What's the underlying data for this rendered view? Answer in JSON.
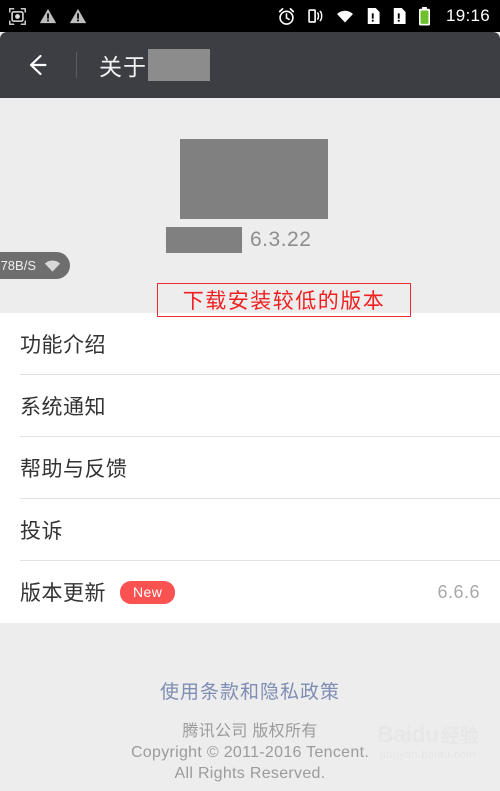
{
  "statusbar": {
    "time": "19:16",
    "left_icons": [
      "screenshot-icon",
      "warning-triangle-icon",
      "warning-triangle-icon"
    ],
    "right_icons": [
      "alarm-clock-icon",
      "vibrate-icon",
      "wifi-icon",
      "sim1-alert-icon",
      "sim2-alert-icon",
      "battery-icon"
    ]
  },
  "header": {
    "back_icon": "back-arrow-icon",
    "title": "关于",
    "title_redacted": true
  },
  "hero": {
    "logo_redacted": true,
    "app_name_redacted": true,
    "version": "6.3.22"
  },
  "speed_overlay": {
    "speed": "78B/S",
    "icon": "wifi-icon"
  },
  "annotation": {
    "text": "下载安装较低的版本",
    "color": "#f02020",
    "border_color": "#ec2d2d"
  },
  "list": {
    "items": [
      {
        "label": "功能介绍",
        "badge": "",
        "value": ""
      },
      {
        "label": "系统通知",
        "badge": "",
        "value": ""
      },
      {
        "label": "帮助与反馈",
        "badge": "",
        "value": ""
      },
      {
        "label": "投诉",
        "badge": "",
        "value": ""
      },
      {
        "label": "版本更新",
        "badge": "New",
        "value": "6.6.6"
      }
    ],
    "badge_color": "#fa5151"
  },
  "footer": {
    "link": "使用条款和隐私政策",
    "link_color": "#7e8db3",
    "copyright_lines": [
      "腾讯公司 版权所有",
      "Copyright © 2011-2016 Tencent.",
      "All Rights Reserved."
    ]
  },
  "watermark": {
    "brand": "Baidu",
    "suffix": "经验",
    "url": "jingyan.baidu.com"
  }
}
